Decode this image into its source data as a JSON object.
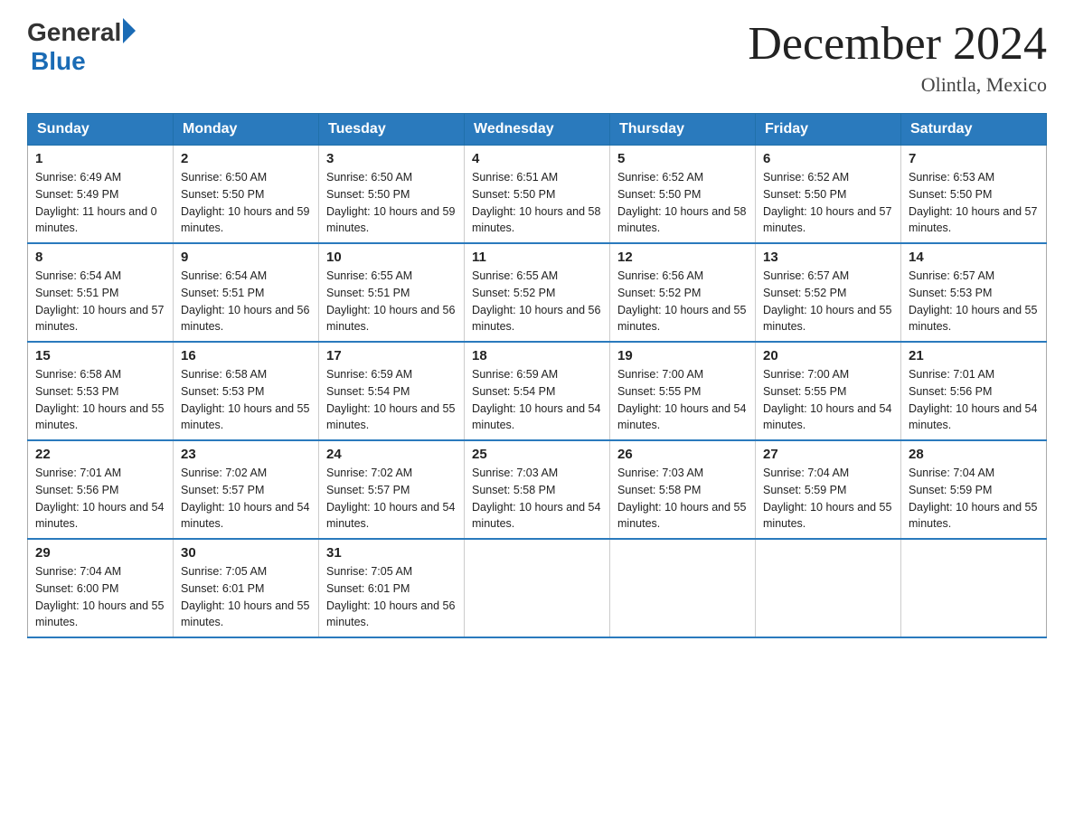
{
  "logo": {
    "general": "General",
    "blue": "Blue"
  },
  "title": {
    "month_year": "December 2024",
    "location": "Olintla, Mexico"
  },
  "header_days": [
    "Sunday",
    "Monday",
    "Tuesday",
    "Wednesday",
    "Thursday",
    "Friday",
    "Saturday"
  ],
  "weeks": [
    [
      {
        "day": "1",
        "sunrise": "6:49 AM",
        "sunset": "5:49 PM",
        "daylight": "11 hours and 0 minutes."
      },
      {
        "day": "2",
        "sunrise": "6:50 AM",
        "sunset": "5:50 PM",
        "daylight": "10 hours and 59 minutes."
      },
      {
        "day": "3",
        "sunrise": "6:50 AM",
        "sunset": "5:50 PM",
        "daylight": "10 hours and 59 minutes."
      },
      {
        "day": "4",
        "sunrise": "6:51 AM",
        "sunset": "5:50 PM",
        "daylight": "10 hours and 58 minutes."
      },
      {
        "day": "5",
        "sunrise": "6:52 AM",
        "sunset": "5:50 PM",
        "daylight": "10 hours and 58 minutes."
      },
      {
        "day": "6",
        "sunrise": "6:52 AM",
        "sunset": "5:50 PM",
        "daylight": "10 hours and 57 minutes."
      },
      {
        "day": "7",
        "sunrise": "6:53 AM",
        "sunset": "5:50 PM",
        "daylight": "10 hours and 57 minutes."
      }
    ],
    [
      {
        "day": "8",
        "sunrise": "6:54 AM",
        "sunset": "5:51 PM",
        "daylight": "10 hours and 57 minutes."
      },
      {
        "day": "9",
        "sunrise": "6:54 AM",
        "sunset": "5:51 PM",
        "daylight": "10 hours and 56 minutes."
      },
      {
        "day": "10",
        "sunrise": "6:55 AM",
        "sunset": "5:51 PM",
        "daylight": "10 hours and 56 minutes."
      },
      {
        "day": "11",
        "sunrise": "6:55 AM",
        "sunset": "5:52 PM",
        "daylight": "10 hours and 56 minutes."
      },
      {
        "day": "12",
        "sunrise": "6:56 AM",
        "sunset": "5:52 PM",
        "daylight": "10 hours and 55 minutes."
      },
      {
        "day": "13",
        "sunrise": "6:57 AM",
        "sunset": "5:52 PM",
        "daylight": "10 hours and 55 minutes."
      },
      {
        "day": "14",
        "sunrise": "6:57 AM",
        "sunset": "5:53 PM",
        "daylight": "10 hours and 55 minutes."
      }
    ],
    [
      {
        "day": "15",
        "sunrise": "6:58 AM",
        "sunset": "5:53 PM",
        "daylight": "10 hours and 55 minutes."
      },
      {
        "day": "16",
        "sunrise": "6:58 AM",
        "sunset": "5:53 PM",
        "daylight": "10 hours and 55 minutes."
      },
      {
        "day": "17",
        "sunrise": "6:59 AM",
        "sunset": "5:54 PM",
        "daylight": "10 hours and 55 minutes."
      },
      {
        "day": "18",
        "sunrise": "6:59 AM",
        "sunset": "5:54 PM",
        "daylight": "10 hours and 54 minutes."
      },
      {
        "day": "19",
        "sunrise": "7:00 AM",
        "sunset": "5:55 PM",
        "daylight": "10 hours and 54 minutes."
      },
      {
        "day": "20",
        "sunrise": "7:00 AM",
        "sunset": "5:55 PM",
        "daylight": "10 hours and 54 minutes."
      },
      {
        "day": "21",
        "sunrise": "7:01 AM",
        "sunset": "5:56 PM",
        "daylight": "10 hours and 54 minutes."
      }
    ],
    [
      {
        "day": "22",
        "sunrise": "7:01 AM",
        "sunset": "5:56 PM",
        "daylight": "10 hours and 54 minutes."
      },
      {
        "day": "23",
        "sunrise": "7:02 AM",
        "sunset": "5:57 PM",
        "daylight": "10 hours and 54 minutes."
      },
      {
        "day": "24",
        "sunrise": "7:02 AM",
        "sunset": "5:57 PM",
        "daylight": "10 hours and 54 minutes."
      },
      {
        "day": "25",
        "sunrise": "7:03 AM",
        "sunset": "5:58 PM",
        "daylight": "10 hours and 54 minutes."
      },
      {
        "day": "26",
        "sunrise": "7:03 AM",
        "sunset": "5:58 PM",
        "daylight": "10 hours and 55 minutes."
      },
      {
        "day": "27",
        "sunrise": "7:04 AM",
        "sunset": "5:59 PM",
        "daylight": "10 hours and 55 minutes."
      },
      {
        "day": "28",
        "sunrise": "7:04 AM",
        "sunset": "5:59 PM",
        "daylight": "10 hours and 55 minutes."
      }
    ],
    [
      {
        "day": "29",
        "sunrise": "7:04 AM",
        "sunset": "6:00 PM",
        "daylight": "10 hours and 55 minutes."
      },
      {
        "day": "30",
        "sunrise": "7:05 AM",
        "sunset": "6:01 PM",
        "daylight": "10 hours and 55 minutes."
      },
      {
        "day": "31",
        "sunrise": "7:05 AM",
        "sunset": "6:01 PM",
        "daylight": "10 hours and 56 minutes."
      },
      null,
      null,
      null,
      null
    ]
  ]
}
